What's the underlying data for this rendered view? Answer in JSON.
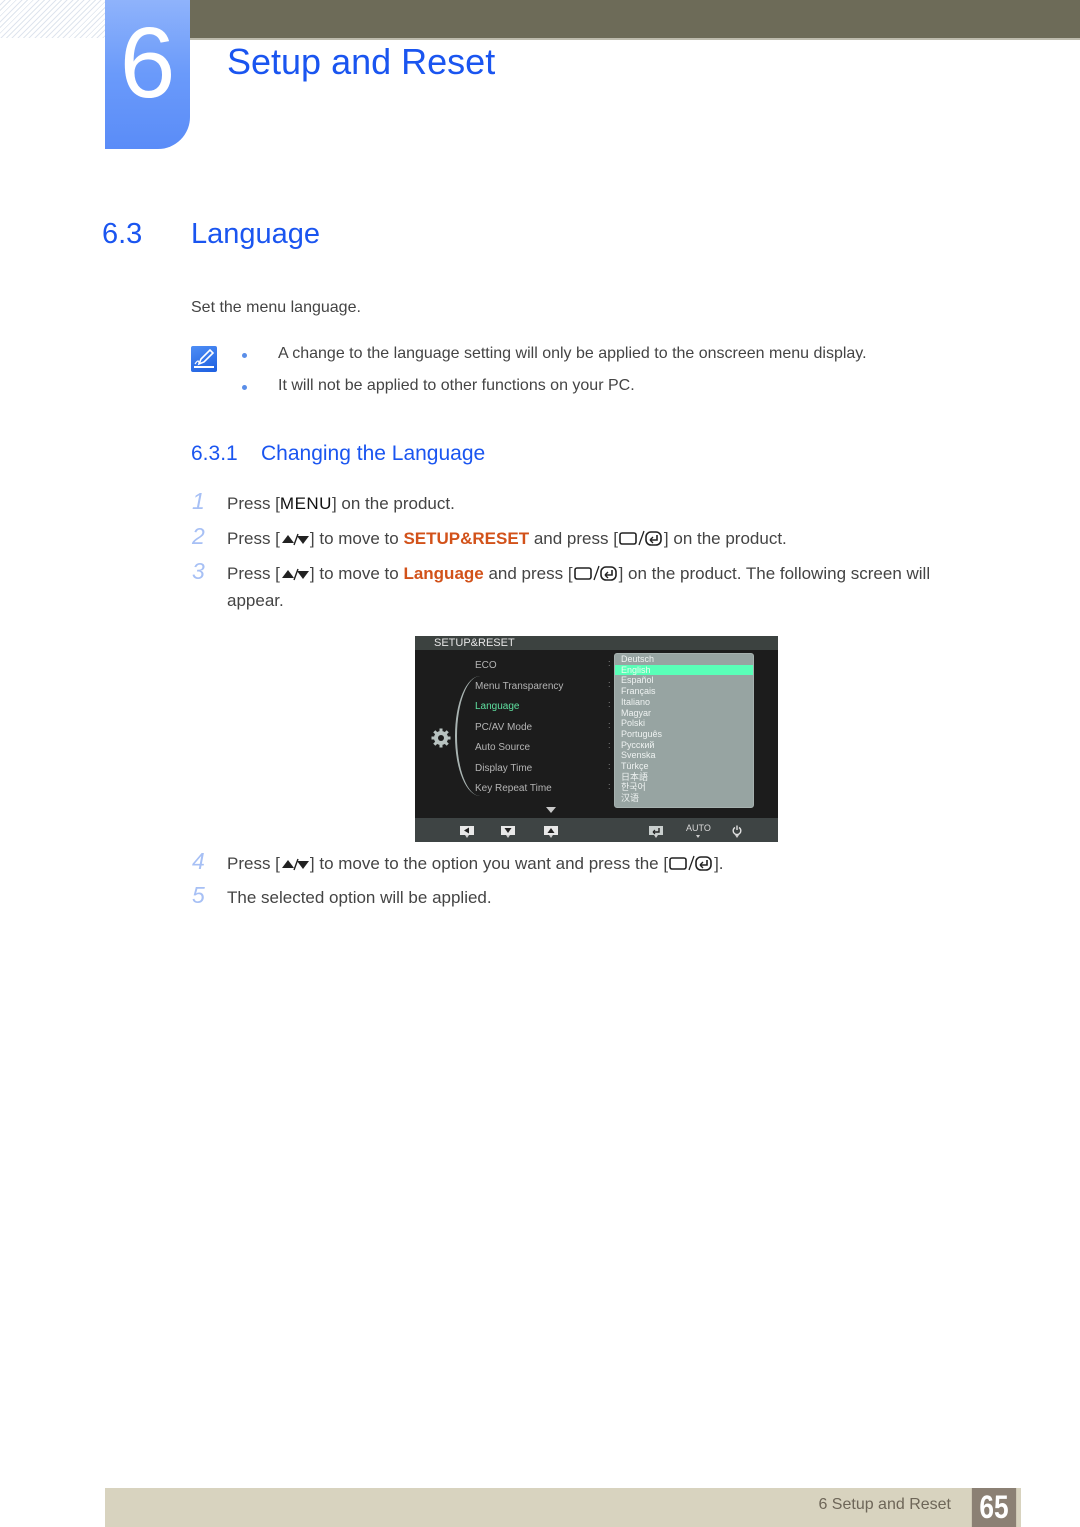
{
  "header": {
    "chapter_number": "6",
    "chapter_title": "Setup and Reset",
    "accent_color": "#1a55f0"
  },
  "section": {
    "number": "6.3",
    "title": "Language",
    "intro": "Set the menu language."
  },
  "notes": {
    "icon": "note-pencil-icon",
    "items": [
      "A change to the language setting will only be applied to the onscreen menu display.",
      "It will not be applied to other functions on your PC."
    ]
  },
  "subsection": {
    "number": "6.3.1",
    "title": "Changing the Language"
  },
  "steps": [
    {
      "num": "1",
      "pre": "Press [",
      "key": "MENU",
      "post": "] on the product."
    },
    {
      "num": "2",
      "pre": "Press [",
      "mid1": "] to move to ",
      "keyword": "SETUP&RESET",
      "mid2": " and press [",
      "post": "] on the product."
    },
    {
      "num": "3",
      "pre": "Press [",
      "mid1": "] to move to ",
      "keyword": "Language",
      "mid2": " and press [",
      "post": "] on the product. The following screen will",
      "cont": "appear."
    },
    {
      "num": "4",
      "pre": "Press [",
      "mid1": "] to move to the option you want and press the [",
      "post": "]."
    },
    {
      "num": "5",
      "text": "The selected option will be applied."
    }
  ],
  "osd": {
    "title": "SETUP&RESET",
    "menu_items": [
      "ECO",
      "Menu Transparency",
      "Language",
      "PC/AV Mode",
      "Auto Source",
      "Display Time",
      "Key Repeat Time"
    ],
    "active_item": "Language",
    "languages": [
      "Deutsch",
      "English",
      "Español",
      "Français",
      "Italiano",
      "Magyar",
      "Polski",
      "Português",
      "Русский",
      "Svenska",
      "Türkçe",
      "日本語",
      "한국어",
      "汉语"
    ],
    "selected_language": "English",
    "footer_buttons": [
      "left-arrow-button",
      "down-arrow-button",
      "up-arrow-button",
      "enter-button",
      "auto-button",
      "power-button"
    ],
    "auto_label": "AUTO"
  },
  "footer": {
    "label": "6 Setup and Reset",
    "page_number": "65"
  }
}
